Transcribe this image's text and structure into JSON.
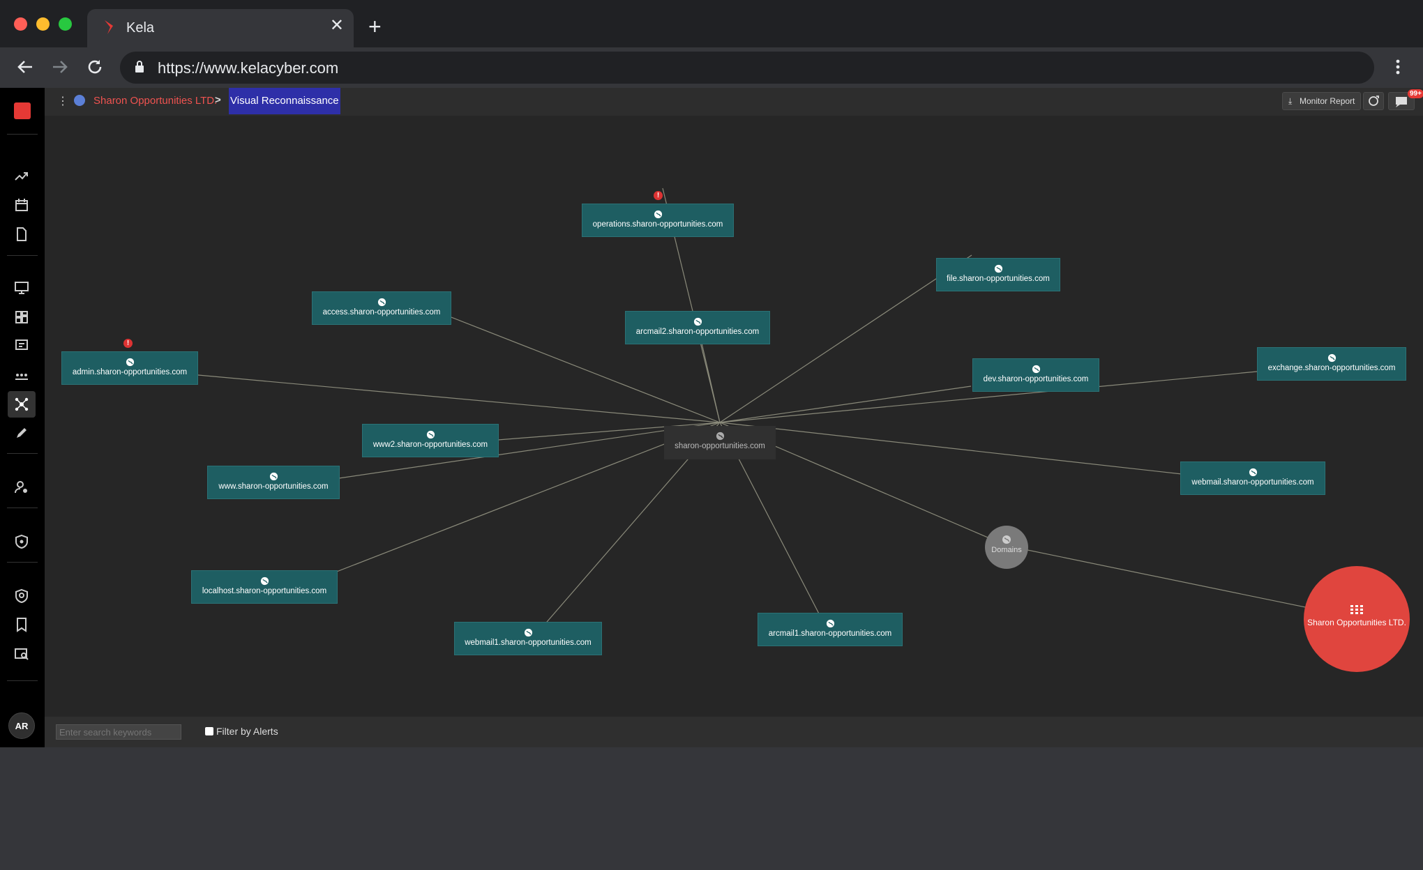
{
  "browser": {
    "tab_title": "Kela",
    "url": "https://www.kelacyber.com"
  },
  "header": {
    "breadcrumb_org": "Sharon Opportunities LTD.",
    "breadcrumb_page": "Visual Reconnaissance",
    "monitor_report_label": "Monitor Report",
    "notification_badge": "99+"
  },
  "graph": {
    "root": "sharon-opportunities.com",
    "nodes": [
      "operations.sharon-opportunities.com",
      "file.sharon-opportunities.com",
      "access.sharon-opportunities.com",
      "arcmail2.sharon-opportunities.com",
      "admin.sharon-opportunities.com",
      "dev.sharon-opportunities.com",
      "exchange.sharon-opportunities.com",
      "www2.sharon-opportunities.com",
      "www.sharon-opportunities.com",
      "webmail.sharon-opportunities.com",
      "localhost.sharon-opportunities.com",
      "webmail1.sharon-opportunities.com",
      "arcmail1.sharon-opportunities.com"
    ],
    "domains_label": "Domains",
    "org_label": "Sharon Opportunities LTD."
  },
  "bottombar": {
    "search_placeholder": "Enter search keywords",
    "filter_label": "Filter by Alerts"
  },
  "user": {
    "initials": "AR"
  },
  "colors": {
    "node_fill": "#1e5e62",
    "org_node": "#e0453e",
    "alert": "#d33333",
    "breadcrumb_org": "#ef5350",
    "active_page_bg": "#2e2fa8"
  }
}
